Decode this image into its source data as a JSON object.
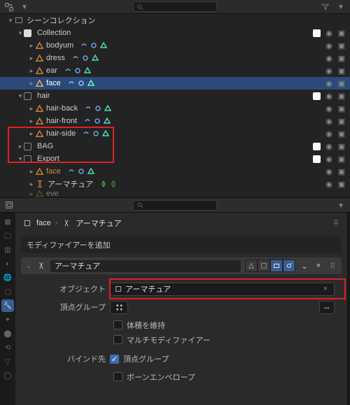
{
  "outliner": {
    "scene_label": "シーンコレクション",
    "items": [
      {
        "type": "collection",
        "name": "Collection",
        "expanded": true
      },
      {
        "type": "mesh",
        "name": "bodyum",
        "indent": 2
      },
      {
        "type": "mesh",
        "name": "dress",
        "indent": 2
      },
      {
        "type": "mesh",
        "name": "ear",
        "indent": 2
      },
      {
        "type": "mesh",
        "name": "face",
        "indent": 2,
        "selected": true
      },
      {
        "type": "collection",
        "name": "hair",
        "indent": 1,
        "expanded": true
      },
      {
        "type": "mesh",
        "name": "hair-back",
        "indent": 2
      },
      {
        "type": "mesh",
        "name": "hair-front",
        "indent": 2
      },
      {
        "type": "mesh",
        "name": "hair-side",
        "indent": 2
      },
      {
        "type": "collection",
        "name": "BAG",
        "indent": 1,
        "expanded": false
      },
      {
        "type": "collection",
        "name": "Export",
        "indent": 1,
        "expanded": true,
        "boxed": true
      },
      {
        "type": "mesh",
        "name": "face",
        "indent": 2,
        "orange": true,
        "boxed": true
      },
      {
        "type": "armature",
        "name": "アーマチュア",
        "indent": 2,
        "boxed": true
      },
      {
        "type": "mesh",
        "name": "eve",
        "indent": 2,
        "faded": true
      }
    ]
  },
  "properties": {
    "crumb_obj": "face",
    "crumb_mod": "アーマチュア",
    "add_label": "モディファイアーを追加",
    "mod_name": "アーマチュア",
    "fields": {
      "object_label": "オブジェクト",
      "object_value": "アーマチュア",
      "vgroup_label": "頂点グループ",
      "preserve": "体積を維持",
      "multi": "マルチモディファイアー",
      "bind_label": "バインド先",
      "bind_vgroup": "頂点グループ",
      "bind_envelope": "ボーンエンベロープ"
    }
  }
}
